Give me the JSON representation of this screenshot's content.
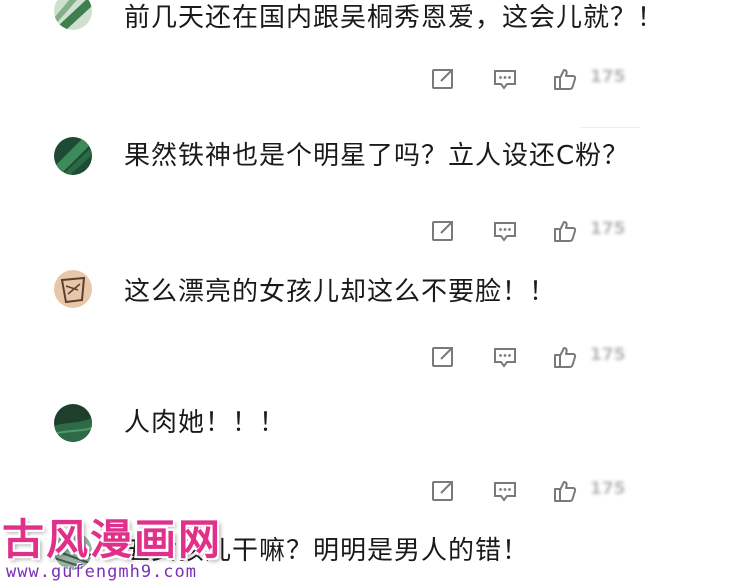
{
  "comments": [
    {
      "text": "前几天还在国内跟吴桐秀恩爱，这会儿就？！",
      "likes": "175"
    },
    {
      "text": "果然铁神也是个明星了吗？立人设还C粉？",
      "likes": "175"
    },
    {
      "text": "这么漂亮的女孩儿却这么不要脸！！",
      "likes": "175"
    },
    {
      "text": "人肉她！！！",
      "likes": "175"
    },
    {
      "text": "五女孩儿干嘛？明明是男人的错！",
      "likes": "175"
    }
  ],
  "actions": {
    "share_icon": "share-icon",
    "comment_icon": "comment-icon",
    "like_icon": "thumbs-up-icon"
  },
  "watermark": {
    "title": "古风漫画网",
    "url": "www.gufengmh9.com"
  },
  "colors": {
    "text": "#1a1a1a",
    "icon": "#7a7a7a",
    "watermark_title": "#e0308a",
    "watermark_url": "#7b2fb5"
  }
}
